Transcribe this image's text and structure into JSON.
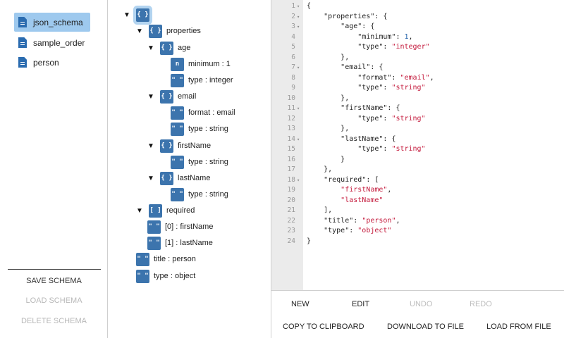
{
  "sidebar": {
    "files": [
      {
        "label": "json_schema",
        "active": true
      },
      {
        "label": "sample_order",
        "active": false
      },
      {
        "label": "person",
        "active": false
      }
    ],
    "actions": [
      {
        "label": "SAVE SCHEMA",
        "enabled": true
      },
      {
        "label": "LOAD SCHEMA",
        "enabled": false
      },
      {
        "label": "DELETE SCHEMA",
        "enabled": false
      }
    ]
  },
  "tree": {
    "badges": {
      "object": "{ }",
      "array": "[ ]",
      "number": "n",
      "string": "\" \""
    },
    "nodes": [
      {
        "label": "",
        "type": "object",
        "expanded": true
      },
      {
        "label": "properties",
        "type": "object",
        "expanded": true
      },
      {
        "label": "age",
        "type": "object",
        "expanded": true
      },
      {
        "label": "minimum : 1",
        "type": "number"
      },
      {
        "label": "type : integer",
        "type": "string"
      },
      {
        "label": "email",
        "type": "object",
        "expanded": true
      },
      {
        "label": "format : email",
        "type": "string"
      },
      {
        "label": "type : string",
        "type": "string"
      },
      {
        "label": "firstName",
        "type": "object",
        "expanded": true
      },
      {
        "label": "type : string",
        "type": "string"
      },
      {
        "label": "lastName",
        "type": "object",
        "expanded": true
      },
      {
        "label": "type : string",
        "type": "string"
      },
      {
        "label": "required",
        "type": "array",
        "expanded": true
      },
      {
        "label": "[0] : firstName",
        "type": "string"
      },
      {
        "label": "[1] : lastName",
        "type": "string"
      },
      {
        "label": "title : person",
        "type": "string"
      },
      {
        "label": "type : object",
        "type": "string"
      }
    ]
  },
  "editor": {
    "lines": [
      {
        "n": "1",
        "fold": true,
        "code": "{"
      },
      {
        "n": "2",
        "fold": true,
        "code": "    \"properties\": {"
      },
      {
        "n": "3",
        "fold": true,
        "code": "        \"age\": {"
      },
      {
        "n": "4",
        "fold": false,
        "code": "            \"minimum\": 1,"
      },
      {
        "n": "5",
        "fold": false,
        "code": "            \"type\": \"integer\""
      },
      {
        "n": "6",
        "fold": false,
        "code": "        },"
      },
      {
        "n": "7",
        "fold": true,
        "code": "        \"email\": {"
      },
      {
        "n": "8",
        "fold": false,
        "code": "            \"format\": \"email\","
      },
      {
        "n": "9",
        "fold": false,
        "code": "            \"type\": \"string\""
      },
      {
        "n": "10",
        "fold": false,
        "code": "        },"
      },
      {
        "n": "11",
        "fold": true,
        "code": "        \"firstName\": {"
      },
      {
        "n": "12",
        "fold": false,
        "code": "            \"type\": \"string\""
      },
      {
        "n": "13",
        "fold": false,
        "code": "        },"
      },
      {
        "n": "14",
        "fold": true,
        "code": "        \"lastName\": {"
      },
      {
        "n": "15",
        "fold": false,
        "code": "            \"type\": \"string\""
      },
      {
        "n": "16",
        "fold": false,
        "code": "        }"
      },
      {
        "n": "17",
        "fold": false,
        "code": "    },"
      },
      {
        "n": "18",
        "fold": true,
        "code": "    \"required\": ["
      },
      {
        "n": "19",
        "fold": false,
        "code": "        \"firstName\","
      },
      {
        "n": "20",
        "fold": false,
        "code": "        \"lastName\""
      },
      {
        "n": "21",
        "fold": false,
        "code": "    ],"
      },
      {
        "n": "22",
        "fold": false,
        "code": "    \"title\": \"person\","
      },
      {
        "n": "23",
        "fold": false,
        "code": "    \"type\": \"object\""
      },
      {
        "n": "24",
        "fold": false,
        "code": "}"
      }
    ]
  },
  "toolbar": {
    "new_label": "NEW",
    "edit_label": "EDIT",
    "undo_label": "UNDO",
    "redo_label": "REDO",
    "copy_label": "COPY TO CLIPBOARD",
    "download_label": "DOWNLOAD TO FILE",
    "load_label": "LOAD FROM FILE"
  },
  "colors": {
    "selected_file_bg": "#9ec9ee",
    "badge_bg": "#3c74ad",
    "string_token": "#c41a3c",
    "number_token": "#1f5fa8",
    "disabled_text": "#bdbdbd"
  }
}
